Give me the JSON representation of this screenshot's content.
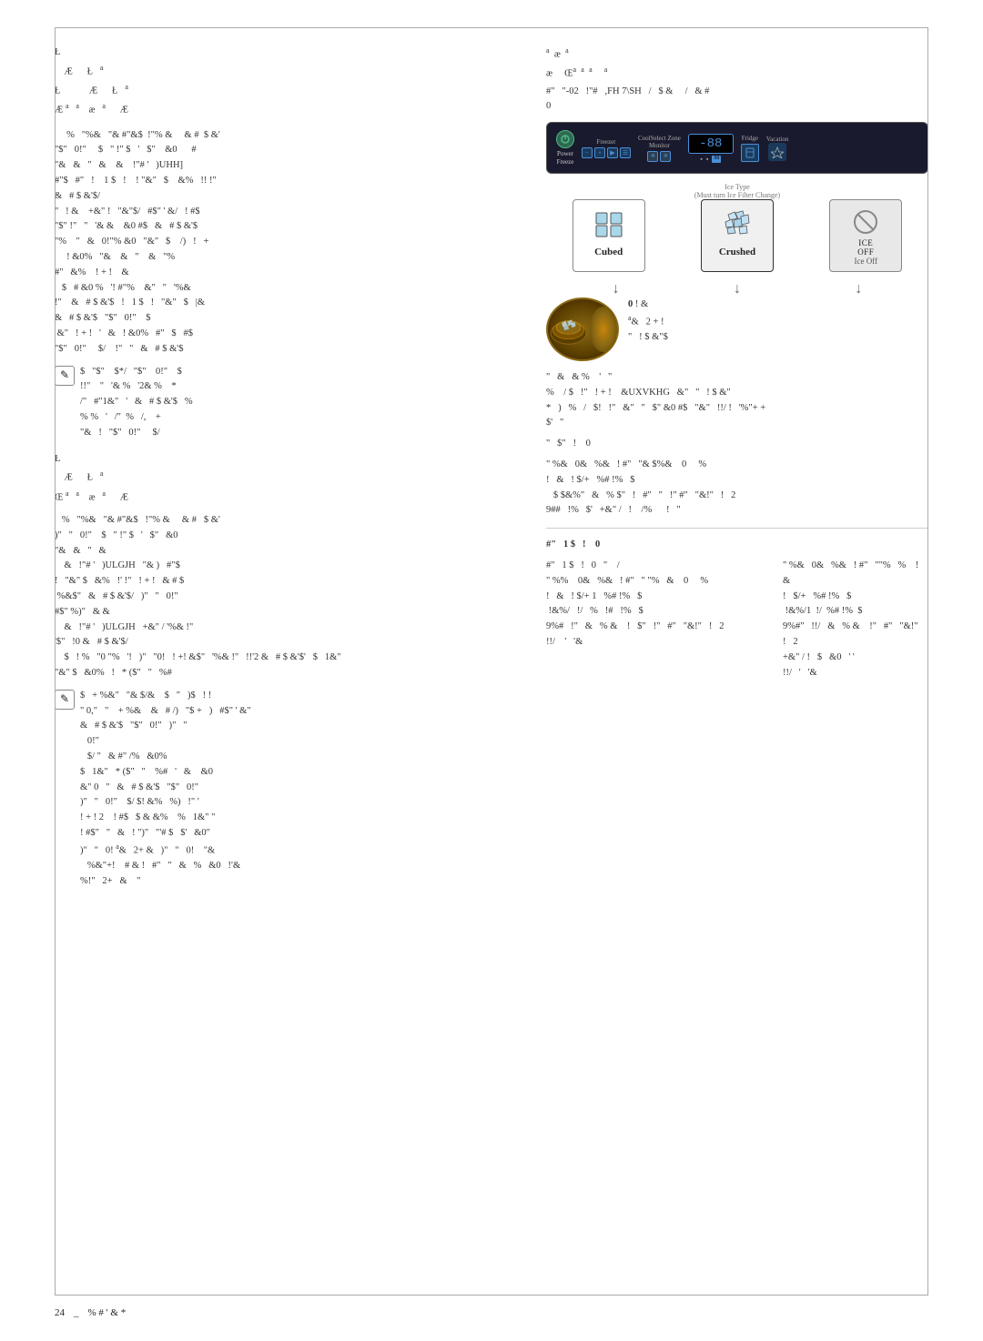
{
  "page": {
    "footer": {
      "page_number": "24",
      "underscore": "_",
      "symbol_text": "% # ' & *"
    }
  },
  "left_column": {
    "section1": {
      "symbol_top": "Ł",
      "title_row": {
        "char1": "Æ",
        "char2": "Ł",
        "super1": "a"
      },
      "subtitle_row": {
        "char1": "Ł",
        "char2": "Æ",
        "char3": "Ł",
        "super1": "a"
      },
      "sub2_row": {
        "char1": "Æ",
        "sup1": "a",
        "sup2": "a",
        "char2": "æ",
        "sup3": "a",
        "char3": "Æ"
      },
      "body_lines": [
        "    %   \"%&   \"& #\"&$  !\"% &    & #  $ &'",
        "\"$\"   0!\"    $   \" !\" $  '  $\"   &0     #",
        "\"&   &  \"   &   &   !\"# '  )UHH]",
        "#\"$  #\"  !   1 $  !   ! \"&\"  $   &%  !! !\"",
        "&   # $ &'$/",
        "\"  ! &   +&\" !  \"&\"$/  #$\" ' &/  ! #$",
        "\"$\" !\"  \"  '& &   &0 #$  &  # $ &'$",
        "\"%   \"  &  0!\"% &0  \"&\"  $   /)  !  +",
        "    ! &0%  \"&   &  \"   &  \"%",
        "#\"  &%   ! + !   &",
        "  $  # &0 %  '! #\"%   &\"  \"  '%&",
        "!\"   &  # $ &'$  !  1 $  !  \"&\"  $  |&",
        "&  # $ &'$  \"$\"  0!\"   $",
        " &\"  ! + !  '  &  ! &0%  #\"  $  #$",
        "\"$\"  0!\"    $/   !\"  \"  &  # $ &'$"
      ]
    },
    "section1_icon_block": {
      "icon_symbol": "✎",
      "text_lines": [
        "$  \"$\"   $*/  \"$\"   0!\"   $",
        "!!\"   \"  '& %  '2& %   *",
        "/\"  #\"1&\"  '  &  # $ &'$  %",
        "% %  '  /\" %  /,   +",
        "\"&  !  \"$\"  0!\"    $/"
      ]
    },
    "section2": {
      "symbol_top": "Ł",
      "title_row": {
        "char1": "Æ",
        "char2": "Ł",
        "super1": "a"
      },
      "subtitle_row": {
        "char1": "Œ",
        "sup1": "a",
        "sup2": "a",
        "char2": "æ",
        "sup3": "a",
        "char3": "Æ"
      },
      "body_lines": [
        "   %  \"%&  \"& #\"&$  !\"% &    & #  $ &'",
        ")\"  \"  0!\"   $  \" !\" $  '  $\"  &0",
        "\"&  &  \"  &",
        "   &  !\"# '  )ULGJH  \"& )  #\"$",
        "!  \"&\" $  &%  !' !\"  ! + !  & # $",
        " %&$\"  &  # $ &'$/  )\"  \"  0!\"",
        "#$\" %) \"  & &",
        "   &  !\"# '  )ULGJH  +&\" / '%& !\"",
        "'$\"  !0 &  # $ &'$/",
        "   $  ! %  \"0 \"%  '!  )\"  \"  0!  ! +!  &$\"  \"  '%& !\"  !!'2 &  # $ &'$'  $  1&\"",
        "\"&\" $  &0%  !  * ($\"  \"  %#"
      ]
    },
    "section2_icon_block": {
      "icon_symbol": "✎",
      "text_lines": [
        "$  + %&\"  \"& $/&   $  \"  )$  ! !",
        "\" 0,\"  \"   + %&   &  # /)  \"$ +  )  #$\" ' &\"",
        "&  # $ &'$  \"$\"  0!\"  )\"  \"",
        "  0!\"",
        "  $/ \"  & #\" /%  &0%",
        "$  1&\"  * ($\"  \"   %#  '  &   &0",
        "&\" 0  \"  &  # $ &'$  \"$\"  0!\"",
        ")\"  \"  0!\"   $/ $! &%  %)  !\" '",
        "! + ! 2   ! #$  $ & &%   %  1&\" \"",
        "! #$\"  \"  &  ! \")\"  \"'# $  $'  &0\"",
        ")\"  \"  0!  a&  2+ &  )\"  \"  0!   \"&",
        "  %&\"+!   # & !  #\"  \"  &  %  &0  !'&",
        "%!\"  2+  &   \""
      ]
    }
  },
  "right_column": {
    "header": {
      "sup1": "a",
      "char1": "æ",
      "sup2": "a",
      "title_chars": [
        "Œ",
        "a",
        "a",
        "a",
        "a"
      ],
      "subtitle_line": "#\"  \"-02  !\"#  ,FH 7\\SH  /  $ &   /  & #"
    },
    "number_zero": "0",
    "control_panel": {
      "power_label": "Power\nFreeze",
      "freezer_label": "Freezer",
      "cool_zone_label": "CoolSelect Zone\nMonitor",
      "temp_display": "-88",
      "temp_sub": "▪ ▪",
      "fridge_label": "Fridge",
      "vacation_label": "Vacation"
    },
    "filter_note": "Ice Type\n(Must turn Ice Filter Change)",
    "ice_types": {
      "section_label": "",
      "cubed": {
        "label": "Cubed",
        "icon": "🧊"
      },
      "crushed": {
        "label": "Crushed",
        "icon": "❄"
      },
      "ice_off": {
        "label": "ICE\nOFF",
        "sublabel": "Ice Off"
      }
    },
    "ice_arrows": [
      "↓",
      "↓",
      "↓"
    ],
    "dispense_section": {
      "number": "0",
      "text1": "! &",
      "text2": "a&  2 + !",
      "text3": "\"  ! $ &\"$"
    },
    "right_text_blocks": [
      {
        "id": "block1",
        "lines": [
          "\"  &  & %   '  \"",
          "%   / $  !\"  ! + !   &UXVKHG  &\"  \"  ! $ &\"",
          "*  )  %  /  $!  !\"  &\"  \"  $\" &0 #$  \"&\"  !!/ ! '%\"+ +",
          "$'  \""
        ]
      },
      {
        "id": "block2",
        "lines": [
          "\"  $\"  !   0"
        ]
      },
      {
        "id": "block3",
        "lines": [
          "\" %&  0&  %&  ! #\"  \"& $%&   0    %",
          "!  &  ! $/+  %# !%  $",
          "  $ $&%\"  &  % $\"  !  #\"  \"  !\" #\"  \"&!\"  !  2",
          "9##  !%  $'  +&\" /  !   /%     !  \""
        ]
      }
    ],
    "right_second_section": {
      "divider_text": "#\"  1 $  !",
      "header_num": "0",
      "lines1": [
        "\" %&  0&  %&  ! #\"  \" \"% &   0    %",
        "!  &  ! $/+  %# !%  $",
        "  $ $& %\"   &  % $\"  !  #\"  \" \"% &!\"  !  2",
        "9##  !%  $'  +&\" / !  $   &0  ' '"
      ],
      "lines2": [
        "#\"  1 $  !  0  \"",
        "\" %%   0&  %&  ! #\"  \"%    %   !  &",
        "!  $/+ 1  %# !%  $",
        " !&%/  !/  %  !#  !%  $",
        "9%#  !\"  &  % &   !  $\"  !\"  #\"  \"&!\"  !  2",
        "!!/   '  '&"
      ]
    }
  }
}
